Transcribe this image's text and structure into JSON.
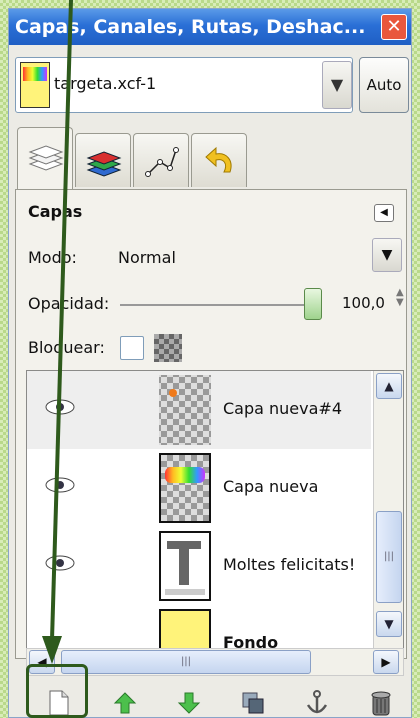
{
  "window": {
    "title": "Capas, Canales, Rutas, Deshac...",
    "close_glyph": "✕"
  },
  "image_selector": {
    "image_name": "targeta.xcf-1",
    "auto_label": "Auto",
    "arrow_glyph": "▼"
  },
  "tabs": [
    {
      "name": "layers-tab-icon",
      "active": true
    },
    {
      "name": "channels-tab-icon",
      "active": false
    },
    {
      "name": "paths-tab-icon",
      "active": false
    },
    {
      "name": "undo-history-tab-icon",
      "active": false
    }
  ],
  "panel": {
    "title": "Capas",
    "mode_label": "Modo:",
    "mode_value": "Normal",
    "opacity_label": "Opacidad:",
    "opacity_value": "100,0",
    "lock_label": "Bloquear:"
  },
  "layers": [
    {
      "name": "Capa nueva#4",
      "visible": true,
      "selected": true,
      "bold": false
    },
    {
      "name": "Capa nueva",
      "visible": true,
      "selected": false,
      "bold": false
    },
    {
      "name": "Moltes felicitats!",
      "visible": true,
      "selected": false,
      "bold": false
    },
    {
      "name": "Fondo",
      "visible": false,
      "selected": false,
      "bold": true
    }
  ],
  "scrollbar": {
    "up": "▲",
    "down": "▼",
    "left": "◀",
    "right": "▶",
    "grip": "|||"
  },
  "toolbar": [
    "new-layer-icon",
    "raise-layer-icon",
    "lower-layer-icon",
    "duplicate-layer-icon",
    "anchor-layer-icon",
    "delete-layer-icon"
  ],
  "colors": {
    "accent_green": "#2e5a1c",
    "title_blue": "#2a6fd6"
  }
}
